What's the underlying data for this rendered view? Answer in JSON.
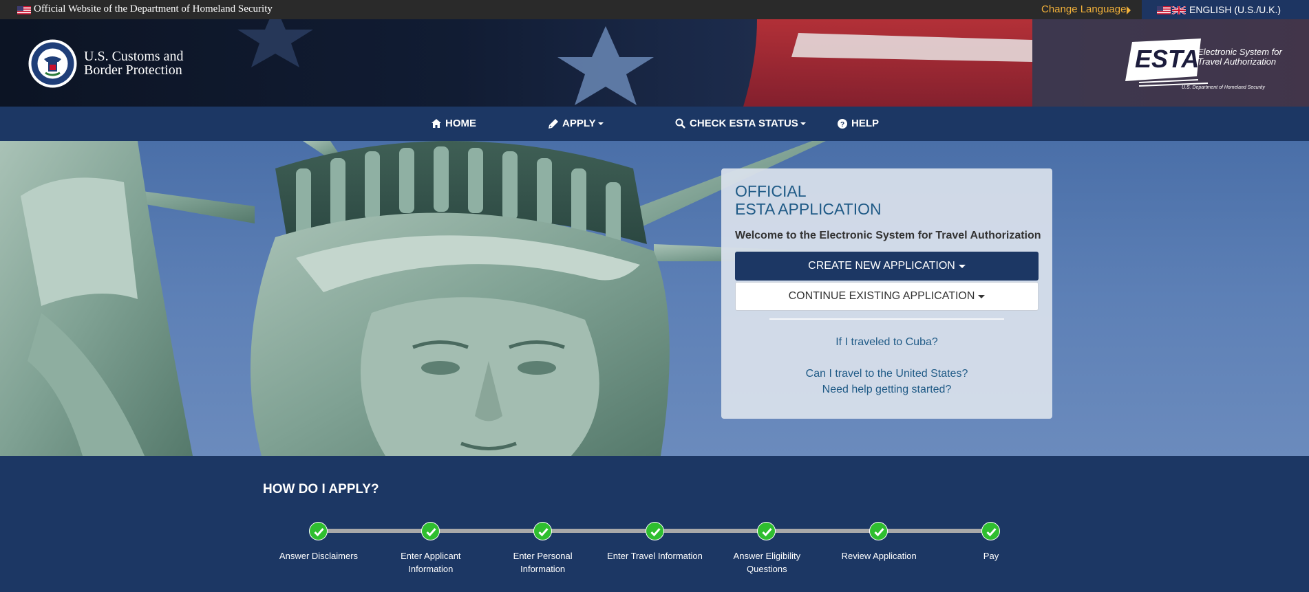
{
  "gov_banner": {
    "text": "Official Website of the Department of Homeland Security",
    "change_language": "Change Language",
    "language": "ENGLISH (U.S./U.K.)"
  },
  "header": {
    "agency_line1": "U.S. Customs and",
    "agency_line2": "Border Protection",
    "esta_logo_text": "ESTA",
    "esta_tagline1": "Electronic System for",
    "esta_tagline2": "Travel Authorization",
    "esta_dept": "U.S. Department of Homeland Security"
  },
  "nav": {
    "items": [
      {
        "label": "HOME",
        "icon": "home-icon"
      },
      {
        "label": "APPLY",
        "icon": "pencil-icon"
      },
      {
        "label": "CHECK ESTA STATUS",
        "icon": "search-icon"
      },
      {
        "label": "HELP",
        "icon": "question-circle-icon"
      }
    ]
  },
  "card": {
    "title_line1": "OFFICIAL",
    "title_line2": "ESTA APPLICATION",
    "welcome": "Welcome to the Electronic System for Travel Authorization",
    "create_button": "CREATE NEW APPLICATION",
    "continue_button": "CONTINUE EXISTING APPLICATION",
    "links": [
      "If I traveled to Cuba?",
      "Can I travel to the United States?",
      "Need help getting started?"
    ]
  },
  "howto": {
    "title": "HOW DO I APPLY?",
    "steps": [
      {
        "line1": "Answer Disclaimers",
        "line2": ""
      },
      {
        "line1": "Enter Applicant",
        "line2": "Information"
      },
      {
        "line1": "Enter Personal",
        "line2": "Information"
      },
      {
        "line1": "Enter Travel Information",
        "line2": ""
      },
      {
        "line1": "Answer Eligibility",
        "line2": "Questions"
      },
      {
        "line1": "Review Application",
        "line2": ""
      },
      {
        "line1": "Pay",
        "line2": ""
      }
    ],
    "step_color": "#2fbe2f",
    "track_color": "#a9a9a9"
  },
  "colors": {
    "navy": "#1c3764",
    "link": "#1f5a86",
    "gold": "#f2b13a"
  }
}
